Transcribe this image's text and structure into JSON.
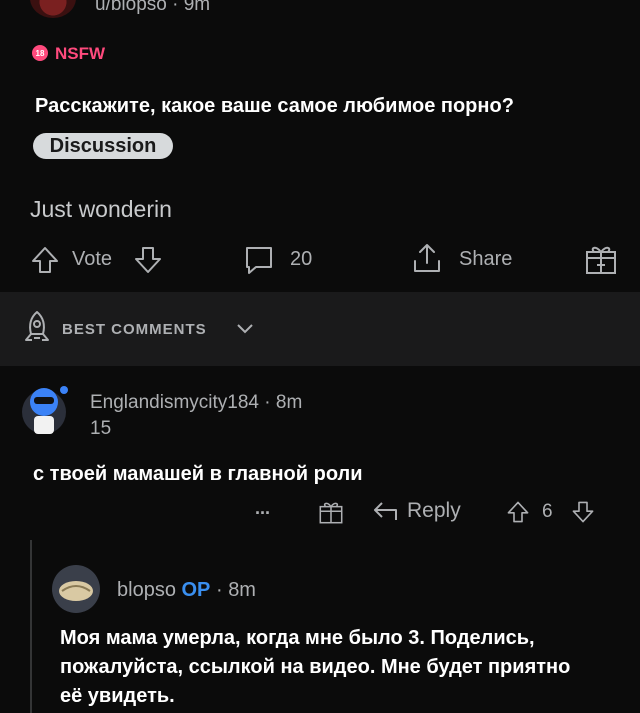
{
  "post": {
    "author": "u/blopso",
    "age": "9m",
    "nsfw_badge": "18",
    "nsfw_label": "NSFW",
    "title": "Расскажите, какое ваше самое любимое порно?",
    "flair": "Discussion",
    "body": "Just wonderin",
    "vote_label": "Vote",
    "comment_count": "20",
    "share_label": "Share"
  },
  "comments_header": {
    "sort_label": "BEST COMMENTS"
  },
  "comment": {
    "author": "Englandismycity184",
    "age": "8m",
    "karma": "15",
    "text": "с твоей мамашей в главной роли",
    "more": "...",
    "reply_label": "Reply",
    "votes": "6"
  },
  "reply": {
    "author": "blopso",
    "op_tag": "OP",
    "age": "8m",
    "lines": [
      "Моя мама умерла, когда мне было 3. Поделись,",
      "пожалуйста, ссылкой на видео. Мне будет приятно",
      "её увидеть."
    ]
  },
  "colors": {
    "nsfw": "#ff4a7d",
    "op": "#3a8ff0",
    "background": "#0b0b0b"
  }
}
